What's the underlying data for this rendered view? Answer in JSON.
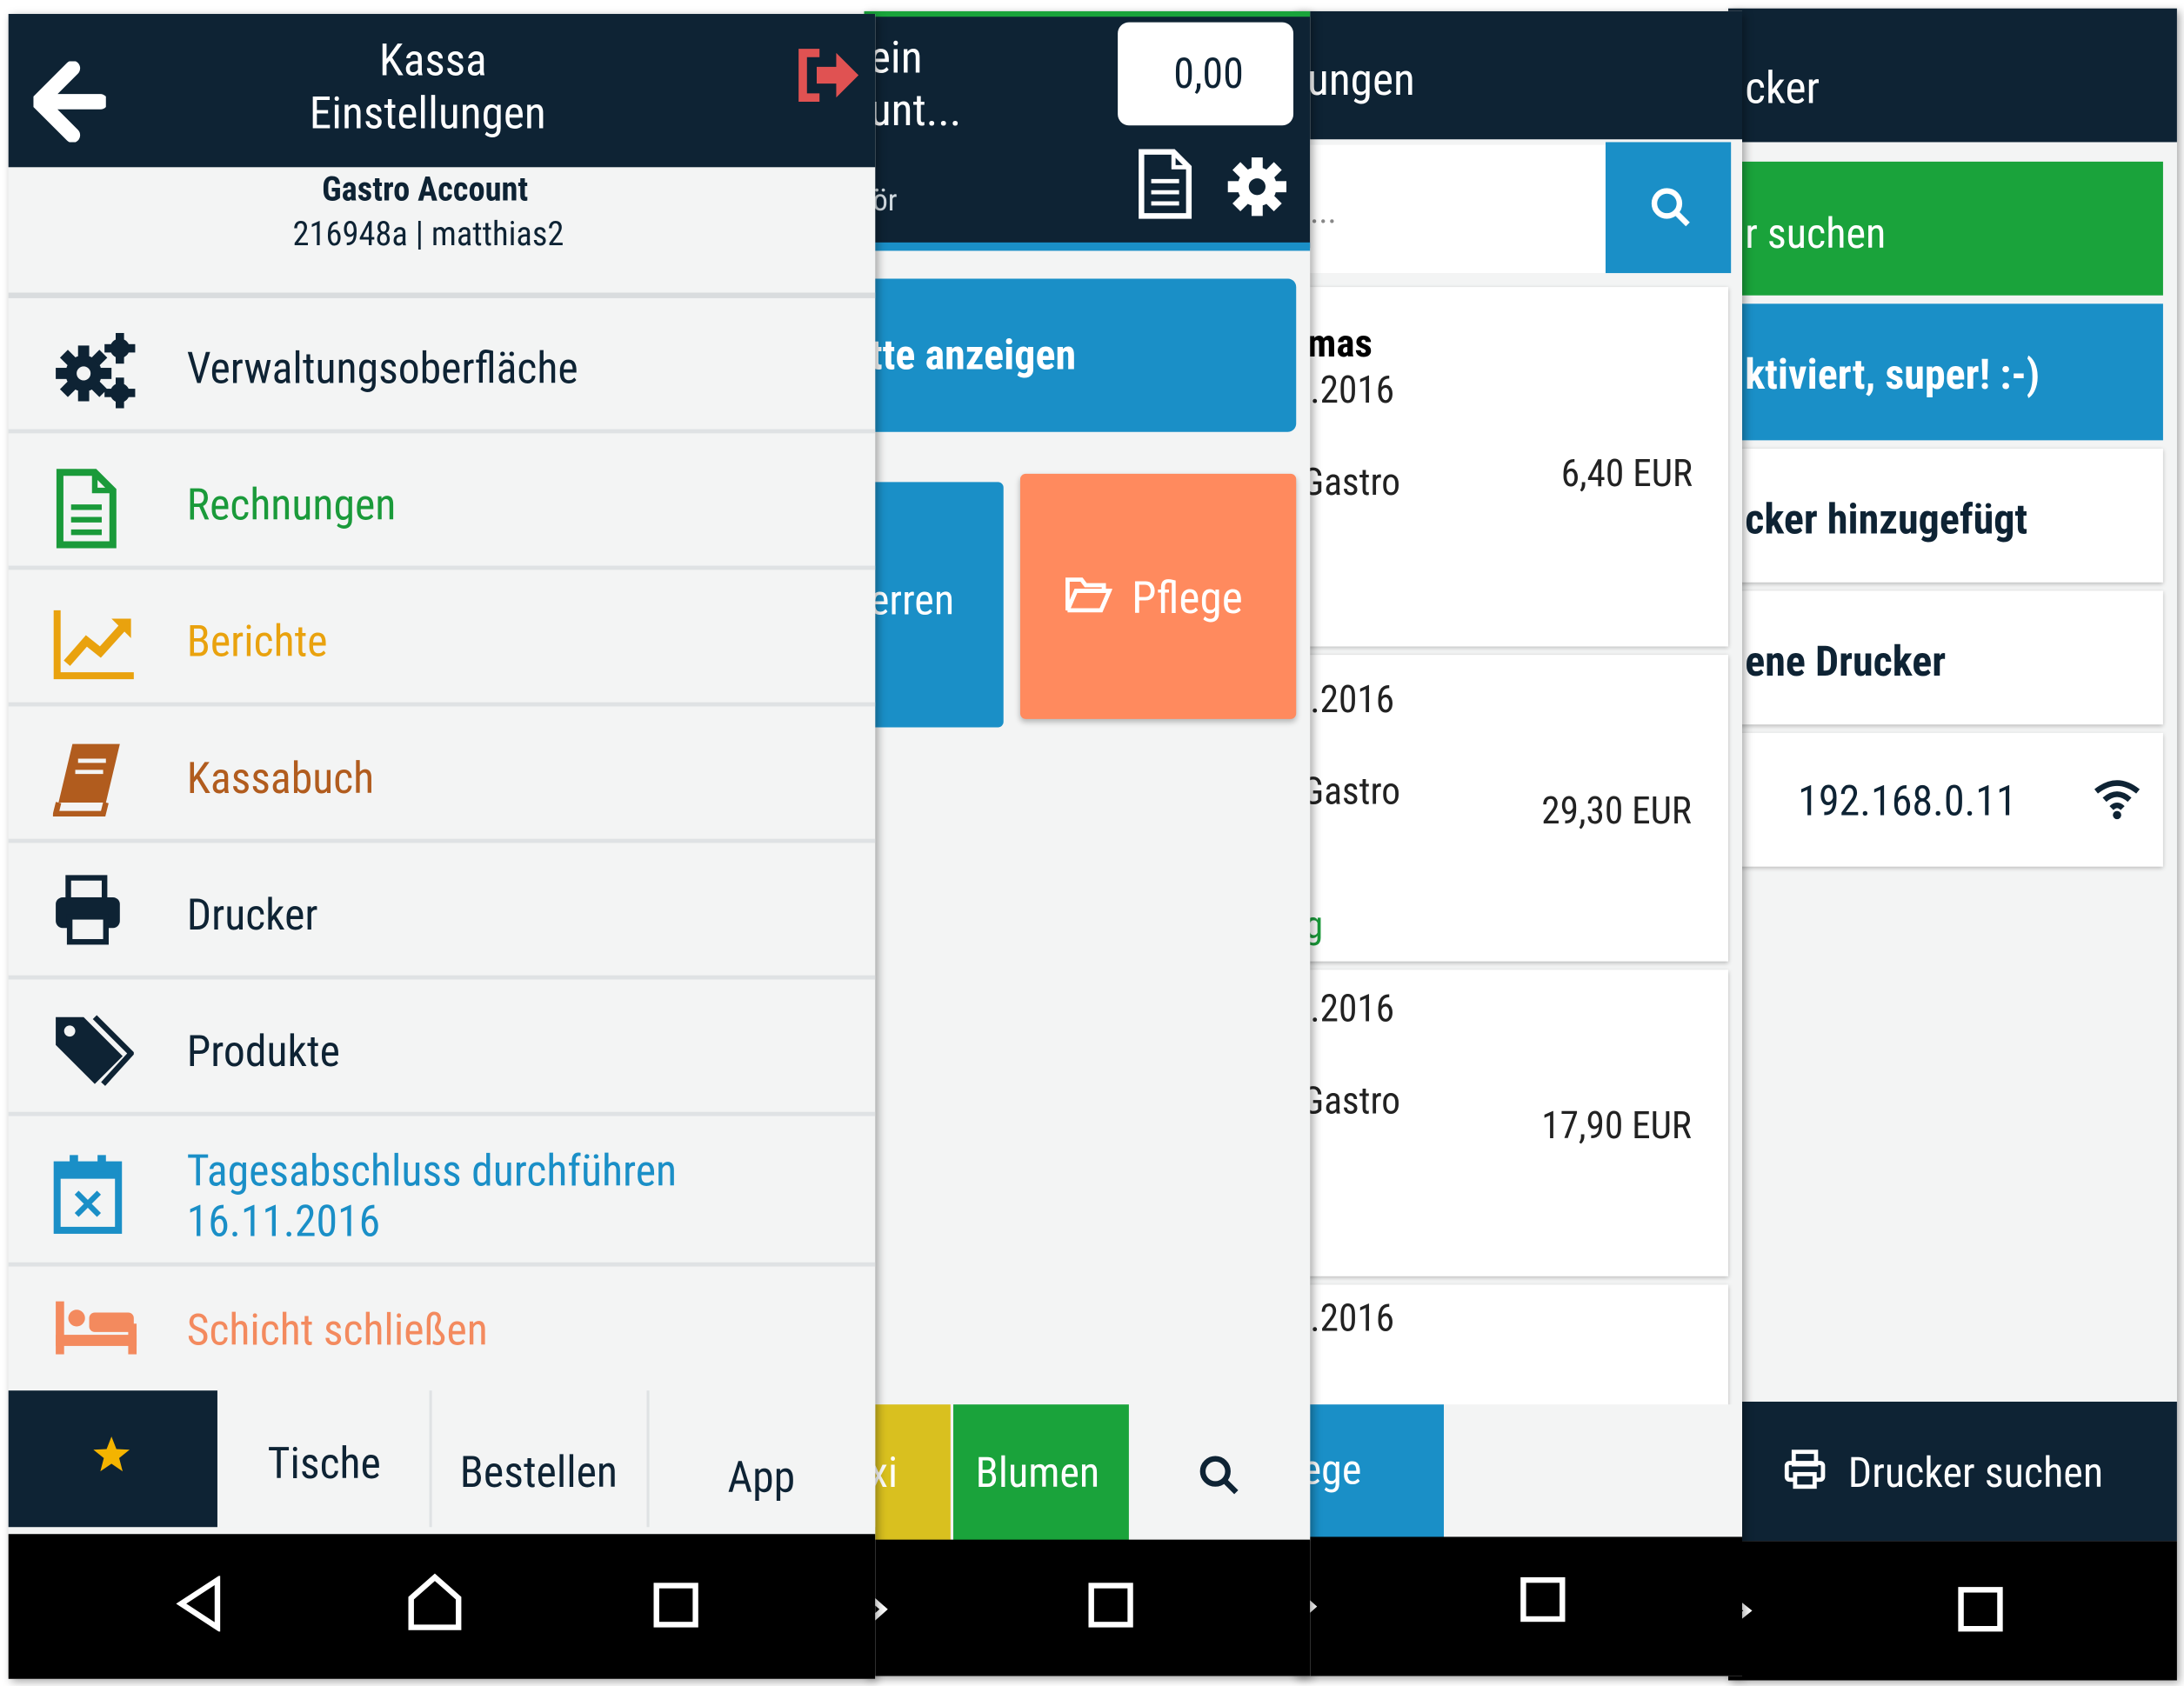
{
  "screen1": {
    "title_line1": "Kassa",
    "title_line2": "Einstellungen",
    "account_name": "Gastro Account",
    "account_id": "216948a | matthias2",
    "menu": [
      {
        "label": "Verwaltungsoberfläche",
        "icon": "gears-icon",
        "color": "#0e2334"
      },
      {
        "label": "Rechnungen",
        "icon": "document-icon",
        "color": "#1a9a3a"
      },
      {
        "label": "Berichte",
        "icon": "chart-line-icon",
        "color": "#e9a20e"
      },
      {
        "label": "Kassabuch",
        "icon": "book-icon",
        "color": "#b15c1e"
      },
      {
        "label": "Drucker",
        "icon": "printer-icon",
        "color": "#0e2334"
      },
      {
        "label": "Produkte",
        "icon": "tags-icon",
        "color": "#0e2334"
      },
      {
        "label": "Tagesabschluss durchführen",
        "label2": "16.11.2016",
        "icon": "calendar-x-icon",
        "color": "#1a8fc7"
      },
      {
        "label": "Schicht schließen",
        "icon": "bed-icon",
        "color": "#f38a5e"
      }
    ],
    "tabs": [
      "Tische",
      "Bestellen",
      "App"
    ]
  },
  "screen2": {
    "title_line1": "ein",
    "title_line2": "unt...",
    "amount": "0,00",
    "subtitle": "ör",
    "blue_button": "tte anzeigen",
    "tile_blue": "erren",
    "tile_orange": "Pflege",
    "tabs": [
      "xi",
      "Blumen"
    ]
  },
  "screen3": {
    "title": "ungen",
    "search_placeholder": "...",
    "cards": [
      {
        "name": "mas",
        "date": ".2016",
        "account": "Gastro",
        "amount": "6,40 EUR",
        "status": ""
      },
      {
        "name": "",
        "date": ".2016",
        "account": "Gastro",
        "amount": "29,30 EUR",
        "status": "g"
      },
      {
        "name": "",
        "date": ".2016",
        "account": "Gastro",
        "amount": "17,90 EUR",
        "status": ""
      },
      {
        "name": "",
        "date": ".2016",
        "account": "",
        "amount": "",
        "status": ""
      }
    ],
    "tab": "ege"
  },
  "screen4": {
    "title": "cker",
    "search_button": "r suchen",
    "activated": "ktiviert, super! :-)",
    "added": "cker hinzugefügt",
    "found": "ene Drucker",
    "ip": "192.168.0.11",
    "bottom_button": "Drucker suchen"
  },
  "colors": {
    "navy": "#0e2334",
    "blue": "#1a8fc7",
    "green": "#1aa33b",
    "orange": "#ff8a5e",
    "yellow": "#d9c01f",
    "logout_red": "#e05252"
  }
}
